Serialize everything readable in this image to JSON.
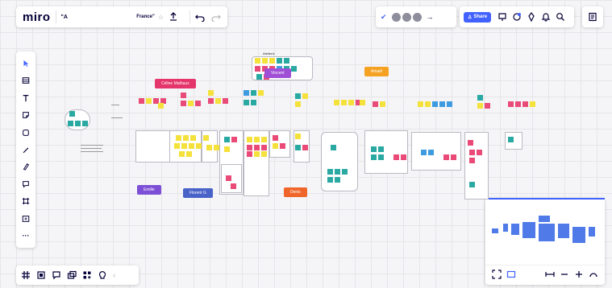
{
  "app": {
    "logo": "miro",
    "board_name": "\"A",
    "board_name_right": "France\""
  },
  "header_right": {
    "share_label": "Share"
  },
  "collaborators": [
    {
      "name": "Céline Mathaux",
      "color": "#e4366b"
    },
    {
      "name": "Vincent",
      "color": "#9f4ed6"
    },
    {
      "name": "Amaël",
      "color": "#f5a223"
    },
    {
      "name": "Emilie",
      "color": "#7c4fd6"
    },
    {
      "name": "Florent G",
      "color": "#4a63c8"
    },
    {
      "name": "Denis",
      "color": "#f0662a"
    }
  ],
  "canvas_labels": {
    "top_group": "Atelier/s"
  },
  "colors": {
    "yellow": "#f5e13c",
    "pink": "#e94a77",
    "teal": "#2aa9a3",
    "blue": "#3f9be0",
    "green": "#6fc26a",
    "accent": "#4262ff"
  },
  "tools": [
    "select-arrow-icon",
    "table-icon",
    "text-icon",
    "sticky-note-icon",
    "shape-icon",
    "pen-icon",
    "eraser-icon",
    "comment-icon",
    "frame-icon",
    "upload-icon",
    "more-icon"
  ],
  "bottom_tools": [
    "grid-icon",
    "frames-icon",
    "comment-list-icon",
    "cards-icon",
    "apps-icon",
    "bulb-icon",
    "collapse-icon"
  ]
}
